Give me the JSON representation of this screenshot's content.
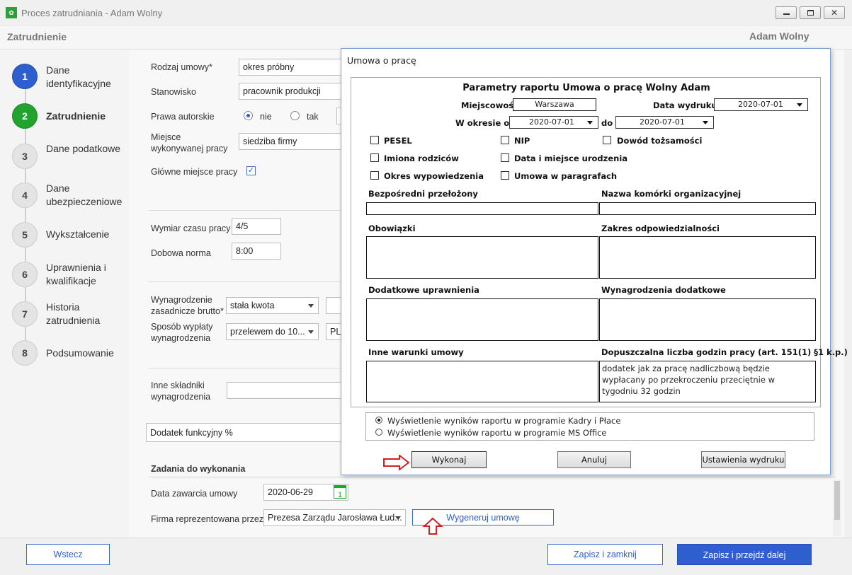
{
  "window": {
    "title": "Proces zatrudniania - Adam Wolny"
  },
  "header": {
    "title": "Zatrudnienie",
    "user": "Adam Wolny"
  },
  "steps": [
    {
      "num": "1",
      "label": "Dane identyfikacyjne"
    },
    {
      "num": "2",
      "label": "Zatrudnienie"
    },
    {
      "num": "3",
      "label": "Dane podatkowe"
    },
    {
      "num": "4",
      "label": "Dane ubezpieczeniowe"
    },
    {
      "num": "5",
      "label": "Wykształcenie"
    },
    {
      "num": "6",
      "label": "Uprawnienia i kwalifikacje"
    },
    {
      "num": "7",
      "label": "Historia zatrudnienia"
    },
    {
      "num": "8",
      "label": "Podsumowanie"
    }
  ],
  "form": {
    "rodzaj_label": "Rodzaj umowy*",
    "rodzaj_value": "okres próbny",
    "stanowisko_label": "Stanowisko",
    "stanowisko_value": "pracownik produkcji",
    "prawa_label": "Prawa autorskie",
    "prawa_opt1": "nie",
    "prawa_opt2": "tak",
    "miejsce_label": "Miejsce wykonywanej pracy",
    "miejsce_value": "siedziba firmy",
    "glowne_label": "Główne miejsce pracy",
    "wymiar_label": "Wymiar czasu pracy",
    "wymiar_value": "4/5",
    "dobowa_label": "Dobowa norma",
    "dobowa_value": "8:00",
    "wynagrodzenie_label": "Wynagrodzenie zasadnicze brutto*",
    "wynagrodzenie_value": "stała kwota",
    "sposob_label": "Sposób wypłaty wynagrodzenia",
    "sposob_value": "przelewem do 10...",
    "sposob_value2": "PL",
    "inne_label": "Inne składniki wynagrodzenia",
    "dodatek_value": "Dodatek funkcyjny %",
    "zadania_heading": "Zadania do wykonania",
    "data_label": "Data zawarcia umowy",
    "data_value": "2020-06-29",
    "calendar_day": "1",
    "firma_label": "Firma reprezentowana przez",
    "firma_value": "Prezesa Zarządu Jarosława Łud...",
    "wygeneruj": "Wygeneruj umowę"
  },
  "footer": {
    "back": "Wstecz",
    "save_close": "Zapisz i zamknij",
    "save_next": "Zapisz i przejdź dalej"
  },
  "dialog": {
    "title": "Umowa o pracę",
    "report_title": "Parametry raportu Umowa o pracę Wolny Adam",
    "miejscowosc_label": "Miejscowość:",
    "miejscowosc_value": "Warszawa",
    "data_wydruku_label": "Data wydruku:",
    "data_wydruku_value": "2020-07-01",
    "okres_od_label": "W okresie od:",
    "okres_od_value": "2020-07-01",
    "do_label": "do",
    "do_value": "2020-07-01",
    "checkboxes": [
      "PESEL",
      "NIP",
      "Dowód tożsamości",
      "Imiona rodziców",
      "Data i miejsce urodzenia",
      "Okres wypowiedzenia",
      "Umowa w paragrafach"
    ],
    "przelozony": "Bezpośredni przełożony",
    "komorka": "Nazwa komórki organizacyjnej",
    "obowiazki": "Obowiązki",
    "zakres": "Zakres odpowiedzialności",
    "uprawnienia": "Dodatkowe uprawnienia",
    "wynagrodzenia_dod": "Wynagrodzenia dodatkowe",
    "inne_warunki": "Inne warunki umowy",
    "godziny_label": "Dopuszczalna liczba godzin pracy (art. 151(1) §1 k.p.)",
    "godziny_value": "dodatek jak za pracę nadliczbową będzie wypłacany po przekroczeniu przeciętnie w tygodniu 32 godzin",
    "radio1": "Wyświetlenie wyników raportu w programie Kadry i Płace",
    "radio2": "Wyświetlenie wyników raportu w programie MS Office",
    "wykonaj": "Wykonaj",
    "anuluj": "Anuluj",
    "ustawienia": "Ustawienia wydruku"
  }
}
